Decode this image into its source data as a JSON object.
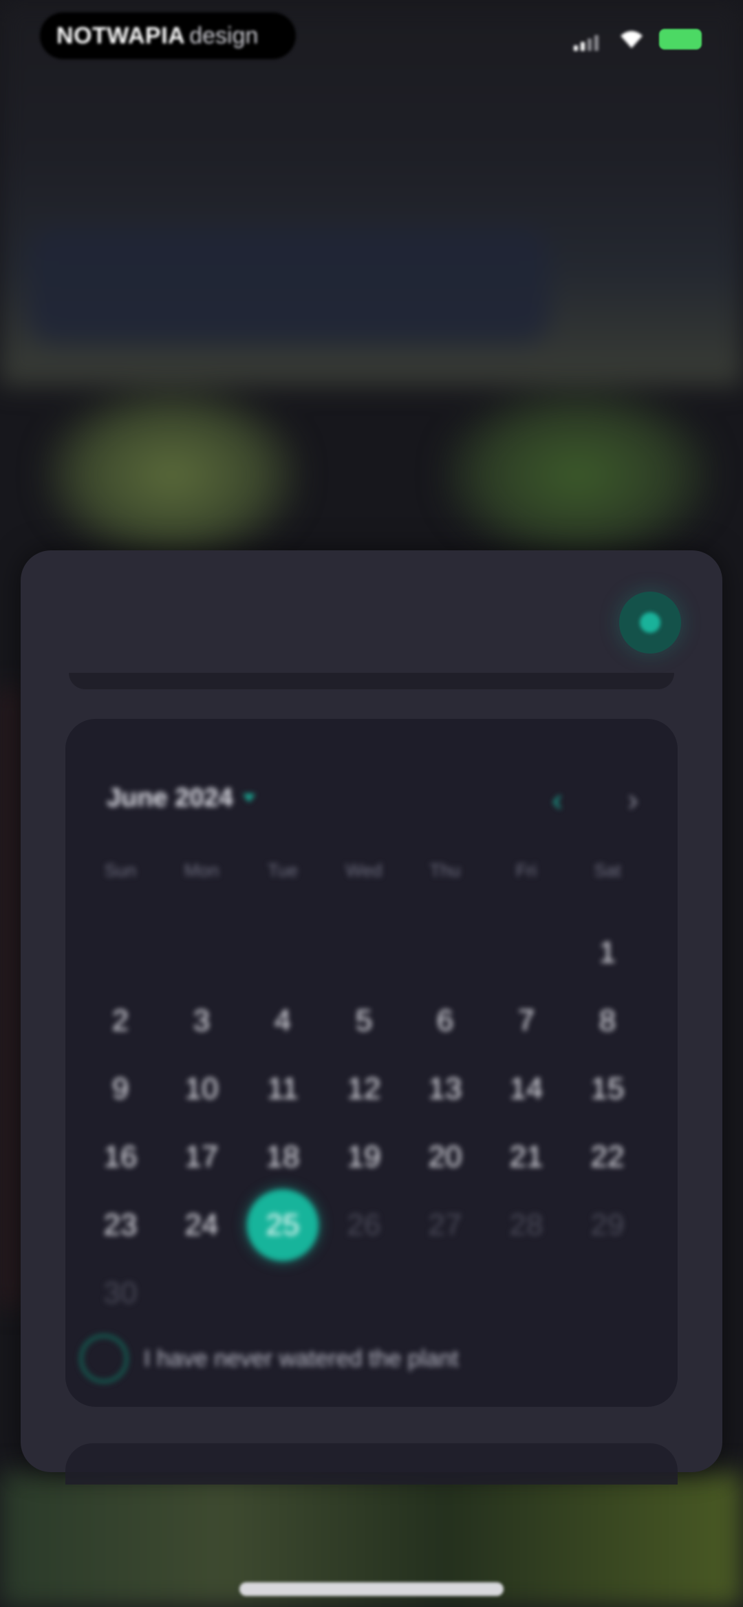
{
  "status_bar": {
    "brand_bold": "NOTWAPIA",
    "brand_light": "design"
  },
  "calendar": {
    "month_label": "June 2024",
    "prev_icon": "‹",
    "next_icon": "›",
    "weekdays": [
      "Sun",
      "Mon",
      "Tue",
      "Wed",
      "Thu",
      "Fri",
      "Sat"
    ],
    "days": [
      {
        "label": "1",
        "state": "normal"
      },
      {
        "label": "2",
        "state": "normal"
      },
      {
        "label": "3",
        "state": "normal"
      },
      {
        "label": "4",
        "state": "normal"
      },
      {
        "label": "5",
        "state": "normal"
      },
      {
        "label": "6",
        "state": "normal"
      },
      {
        "label": "7",
        "state": "normal"
      },
      {
        "label": "8",
        "state": "normal"
      },
      {
        "label": "9",
        "state": "normal"
      },
      {
        "label": "10",
        "state": "normal"
      },
      {
        "label": "11",
        "state": "normal"
      },
      {
        "label": "12",
        "state": "normal"
      },
      {
        "label": "13",
        "state": "normal"
      },
      {
        "label": "14",
        "state": "normal"
      },
      {
        "label": "15",
        "state": "normal"
      },
      {
        "label": "16",
        "state": "normal"
      },
      {
        "label": "17",
        "state": "normal"
      },
      {
        "label": "18",
        "state": "normal"
      },
      {
        "label": "19",
        "state": "normal"
      },
      {
        "label": "20",
        "state": "normal"
      },
      {
        "label": "21",
        "state": "normal"
      },
      {
        "label": "22",
        "state": "normal"
      },
      {
        "label": "23",
        "state": "normal"
      },
      {
        "label": "24",
        "state": "normal"
      },
      {
        "label": "25",
        "state": "selected"
      },
      {
        "label": "26",
        "state": "muted"
      },
      {
        "label": "27",
        "state": "muted"
      },
      {
        "label": "28",
        "state": "muted"
      },
      {
        "label": "29",
        "state": "muted"
      },
      {
        "label": "30",
        "state": "muted"
      }
    ],
    "first_weekday_index": 6,
    "checkbox_label": "I have never watered the plant",
    "checkbox_checked": false
  },
  "colors": {
    "accent": "#17b49b",
    "sheet": "#2b2a36",
    "card": "#1e1d29",
    "battery": "#4cd964"
  },
  "icons": {
    "close": "close-icon",
    "signal": "cellular-signal-icon",
    "wifi": "wifi-icon",
    "battery": "battery-icon",
    "month_dropdown": "chevron-down-icon",
    "prev": "chevron-left-icon",
    "next": "chevron-right-icon"
  }
}
